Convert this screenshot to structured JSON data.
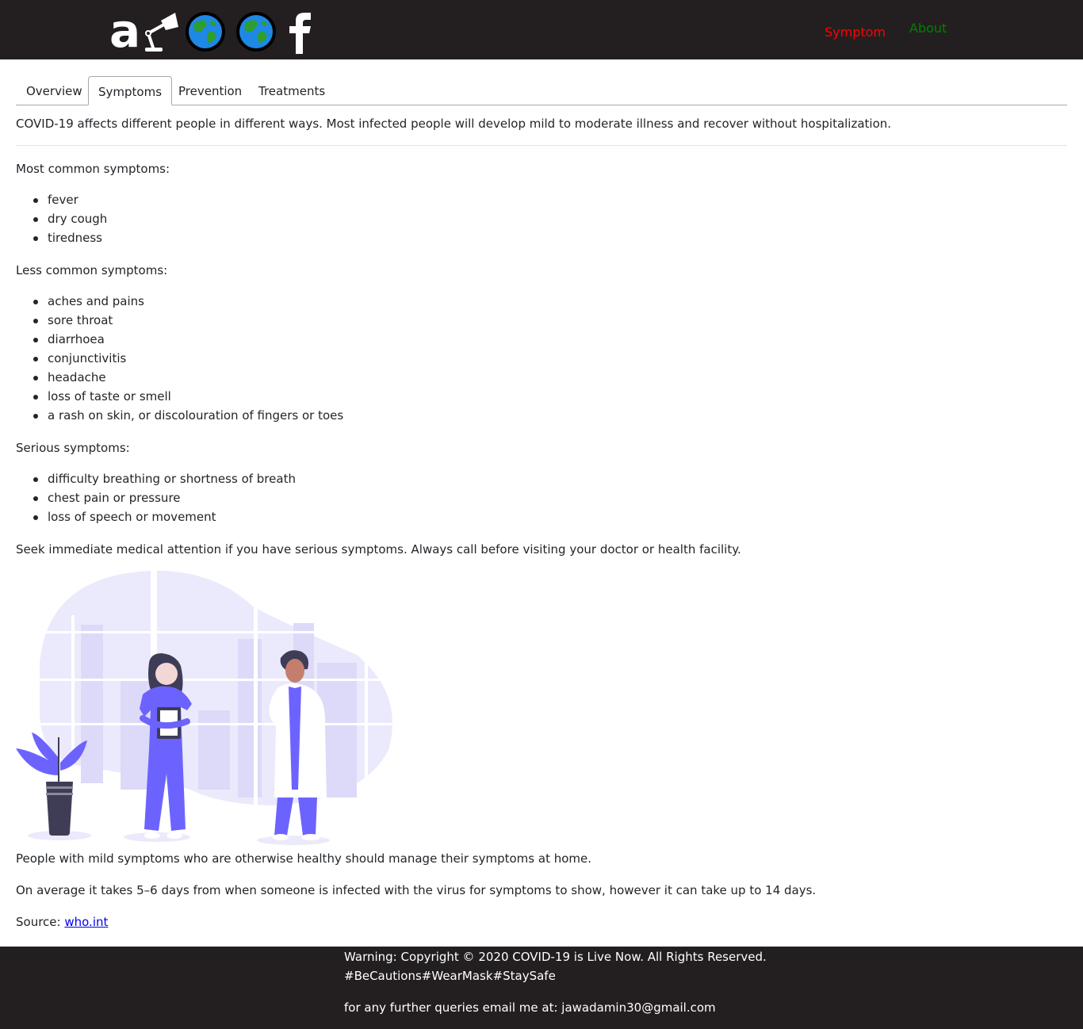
{
  "header": {
    "logo_letter": "a",
    "nav": {
      "symptom": "Symptom",
      "about": "About"
    },
    "colors": {
      "bar": "#231f20",
      "symptom": "#ff0000",
      "about": "#008000"
    },
    "icons": [
      "desk-lamp-icon",
      "globe-icon",
      "globe-icon",
      "facebook-icon"
    ]
  },
  "tabs": [
    "Overview",
    "Symptoms",
    "Prevention",
    "Treatments"
  ],
  "active_tab": "Symptoms",
  "content": {
    "intro": "COVID-19 affects different people in different ways. Most infected people will develop mild to moderate illness and recover without hospitalization.",
    "common_heading": "Most common symptoms:",
    "common": [
      "fever",
      "dry cough",
      "tiredness"
    ],
    "less_heading": "Less common symptoms:",
    "less": [
      "aches and pains",
      "sore throat",
      "diarrhoea",
      "conjunctivitis",
      "headache",
      "loss of taste or smell",
      "a rash on skin, or discolouration of fingers or toes"
    ],
    "serious_heading": "Serious symptoms:",
    "serious": [
      "difficulty breathing or shortness of breath",
      "chest pain or pressure",
      "loss of speech or movement"
    ],
    "seek": "Seek immediate medical attention if you have serious symptoms. Always call before visiting your doctor or health facility.",
    "mild": "People with mild symptoms who are otherwise healthy should manage their symptoms at home.",
    "average": "On average it takes 5–6 days from when someone is infected with the virus for symptoms to show, however it can take up to 14 days.",
    "source_label": "Source:",
    "source_link": "who.int"
  },
  "footer": {
    "copyright": "Warning: Copyright © 2020 COVID-19 is Live Now. All Rights Reserved.",
    "hashtags": "#BeCautions#WearMask#StaySafe",
    "email_line": "for any further queries email me at: jawadamin30@gmail.com"
  }
}
